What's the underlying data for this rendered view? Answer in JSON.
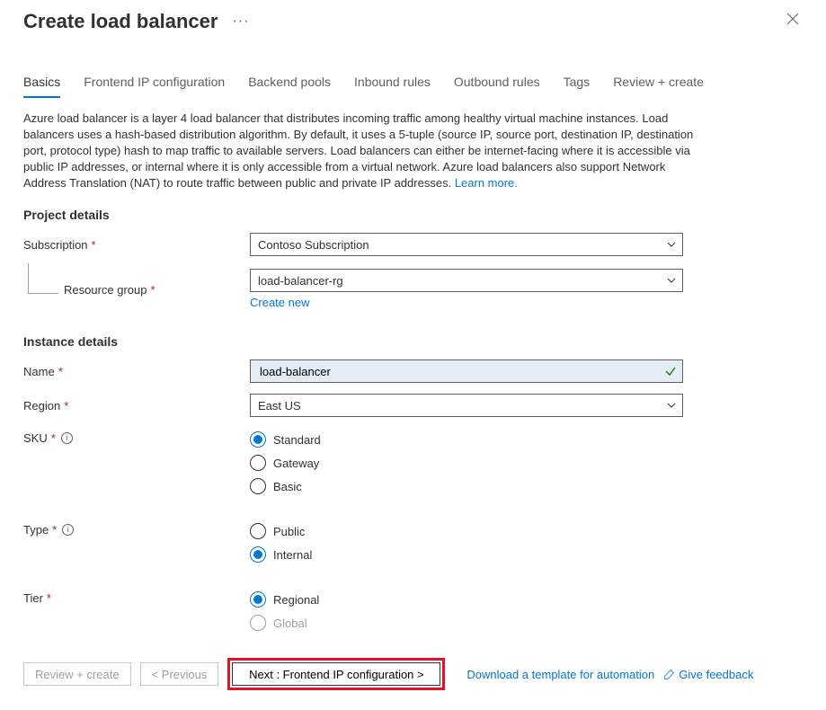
{
  "header": {
    "title": "Create load balancer"
  },
  "tabs": [
    {
      "label": "Basics",
      "active": true
    },
    {
      "label": "Frontend IP configuration",
      "active": false
    },
    {
      "label": "Backend pools",
      "active": false
    },
    {
      "label": "Inbound rules",
      "active": false
    },
    {
      "label": "Outbound rules",
      "active": false
    },
    {
      "label": "Tags",
      "active": false
    },
    {
      "label": "Review + create",
      "active": false
    }
  ],
  "description": "Azure load balancer is a layer 4 load balancer that distributes incoming traffic among healthy virtual machine instances. Load balancers uses a hash-based distribution algorithm. By default, it uses a 5-tuple (source IP, source port, destination IP, destination port, protocol type) hash to map traffic to available servers. Load balancers can either be internet-facing where it is accessible via public IP addresses, or internal where it is only accessible from a virtual network. Azure load balancers also support Network Address Translation (NAT) to route traffic between public and private IP addresses.  ",
  "learn_more": "Learn more.",
  "sections": {
    "project_h": "Project details",
    "instance_h": "Instance details"
  },
  "labels": {
    "subscription": "Subscription",
    "rg": "Resource group",
    "create_new": "Create new",
    "name": "Name",
    "region": "Region",
    "sku": "SKU",
    "type": "Type",
    "tier": "Tier"
  },
  "values": {
    "subscription": "Contoso Subscription",
    "rg": "load-balancer-rg",
    "name": "load-balancer",
    "region": "East US"
  },
  "sku_options": [
    {
      "label": "Standard",
      "checked": true
    },
    {
      "label": "Gateway",
      "checked": false
    },
    {
      "label": "Basic",
      "checked": false
    }
  ],
  "type_options": [
    {
      "label": "Public",
      "checked": false
    },
    {
      "label": "Internal",
      "checked": true
    }
  ],
  "tier_options": [
    {
      "label": "Regional",
      "checked": true,
      "disabled": false
    },
    {
      "label": "Global",
      "checked": false,
      "disabled": true
    }
  ],
  "footer": {
    "review": "Review + create",
    "previous": "< Previous",
    "next": "Next : Frontend IP configuration >",
    "download": "Download a template for automation",
    "feedback": "Give feedback"
  }
}
